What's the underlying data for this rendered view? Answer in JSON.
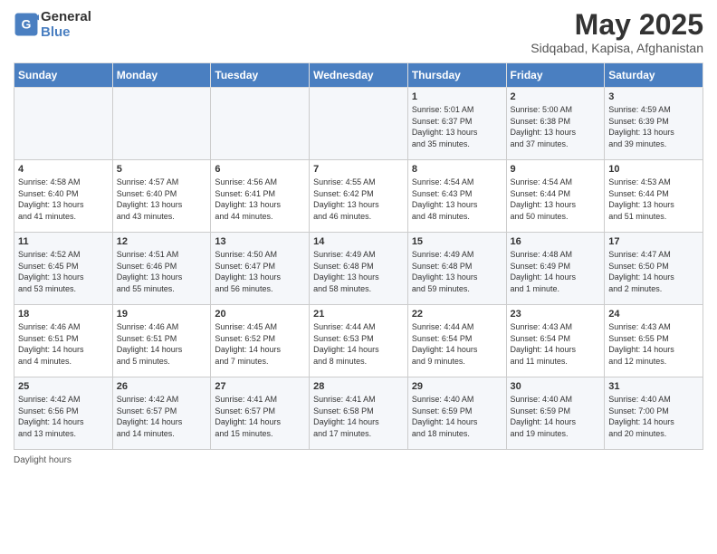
{
  "header": {
    "logo_line1": "General",
    "logo_line2": "Blue",
    "title": "May 2025",
    "subtitle": "Sidqabad, Kapisa, Afghanistan"
  },
  "days_of_week": [
    "Sunday",
    "Monday",
    "Tuesday",
    "Wednesday",
    "Thursday",
    "Friday",
    "Saturday"
  ],
  "weeks": [
    [
      {
        "day": "",
        "info": ""
      },
      {
        "day": "",
        "info": ""
      },
      {
        "day": "",
        "info": ""
      },
      {
        "day": "",
        "info": ""
      },
      {
        "day": "1",
        "info": "Sunrise: 5:01 AM\nSunset: 6:37 PM\nDaylight: 13 hours\nand 35 minutes."
      },
      {
        "day": "2",
        "info": "Sunrise: 5:00 AM\nSunset: 6:38 PM\nDaylight: 13 hours\nand 37 minutes."
      },
      {
        "day": "3",
        "info": "Sunrise: 4:59 AM\nSunset: 6:39 PM\nDaylight: 13 hours\nand 39 minutes."
      }
    ],
    [
      {
        "day": "4",
        "info": "Sunrise: 4:58 AM\nSunset: 6:40 PM\nDaylight: 13 hours\nand 41 minutes."
      },
      {
        "day": "5",
        "info": "Sunrise: 4:57 AM\nSunset: 6:40 PM\nDaylight: 13 hours\nand 43 minutes."
      },
      {
        "day": "6",
        "info": "Sunrise: 4:56 AM\nSunset: 6:41 PM\nDaylight: 13 hours\nand 44 minutes."
      },
      {
        "day": "7",
        "info": "Sunrise: 4:55 AM\nSunset: 6:42 PM\nDaylight: 13 hours\nand 46 minutes."
      },
      {
        "day": "8",
        "info": "Sunrise: 4:54 AM\nSunset: 6:43 PM\nDaylight: 13 hours\nand 48 minutes."
      },
      {
        "day": "9",
        "info": "Sunrise: 4:54 AM\nSunset: 6:44 PM\nDaylight: 13 hours\nand 50 minutes."
      },
      {
        "day": "10",
        "info": "Sunrise: 4:53 AM\nSunset: 6:44 PM\nDaylight: 13 hours\nand 51 minutes."
      }
    ],
    [
      {
        "day": "11",
        "info": "Sunrise: 4:52 AM\nSunset: 6:45 PM\nDaylight: 13 hours\nand 53 minutes."
      },
      {
        "day": "12",
        "info": "Sunrise: 4:51 AM\nSunset: 6:46 PM\nDaylight: 13 hours\nand 55 minutes."
      },
      {
        "day": "13",
        "info": "Sunrise: 4:50 AM\nSunset: 6:47 PM\nDaylight: 13 hours\nand 56 minutes."
      },
      {
        "day": "14",
        "info": "Sunrise: 4:49 AM\nSunset: 6:48 PM\nDaylight: 13 hours\nand 58 minutes."
      },
      {
        "day": "15",
        "info": "Sunrise: 4:49 AM\nSunset: 6:48 PM\nDaylight: 13 hours\nand 59 minutes."
      },
      {
        "day": "16",
        "info": "Sunrise: 4:48 AM\nSunset: 6:49 PM\nDaylight: 14 hours\nand 1 minute."
      },
      {
        "day": "17",
        "info": "Sunrise: 4:47 AM\nSunset: 6:50 PM\nDaylight: 14 hours\nand 2 minutes."
      }
    ],
    [
      {
        "day": "18",
        "info": "Sunrise: 4:46 AM\nSunset: 6:51 PM\nDaylight: 14 hours\nand 4 minutes."
      },
      {
        "day": "19",
        "info": "Sunrise: 4:46 AM\nSunset: 6:51 PM\nDaylight: 14 hours\nand 5 minutes."
      },
      {
        "day": "20",
        "info": "Sunrise: 4:45 AM\nSunset: 6:52 PM\nDaylight: 14 hours\nand 7 minutes."
      },
      {
        "day": "21",
        "info": "Sunrise: 4:44 AM\nSunset: 6:53 PM\nDaylight: 14 hours\nand 8 minutes."
      },
      {
        "day": "22",
        "info": "Sunrise: 4:44 AM\nSunset: 6:54 PM\nDaylight: 14 hours\nand 9 minutes."
      },
      {
        "day": "23",
        "info": "Sunrise: 4:43 AM\nSunset: 6:54 PM\nDaylight: 14 hours\nand 11 minutes."
      },
      {
        "day": "24",
        "info": "Sunrise: 4:43 AM\nSunset: 6:55 PM\nDaylight: 14 hours\nand 12 minutes."
      }
    ],
    [
      {
        "day": "25",
        "info": "Sunrise: 4:42 AM\nSunset: 6:56 PM\nDaylight: 14 hours\nand 13 minutes."
      },
      {
        "day": "26",
        "info": "Sunrise: 4:42 AM\nSunset: 6:57 PM\nDaylight: 14 hours\nand 14 minutes."
      },
      {
        "day": "27",
        "info": "Sunrise: 4:41 AM\nSunset: 6:57 PM\nDaylight: 14 hours\nand 15 minutes."
      },
      {
        "day": "28",
        "info": "Sunrise: 4:41 AM\nSunset: 6:58 PM\nDaylight: 14 hours\nand 17 minutes."
      },
      {
        "day": "29",
        "info": "Sunrise: 4:40 AM\nSunset: 6:59 PM\nDaylight: 14 hours\nand 18 minutes."
      },
      {
        "day": "30",
        "info": "Sunrise: 4:40 AM\nSunset: 6:59 PM\nDaylight: 14 hours\nand 19 minutes."
      },
      {
        "day": "31",
        "info": "Sunrise: 4:40 AM\nSunset: 7:00 PM\nDaylight: 14 hours\nand 20 minutes."
      }
    ]
  ],
  "footer": {
    "daylight_label": "Daylight hours"
  }
}
